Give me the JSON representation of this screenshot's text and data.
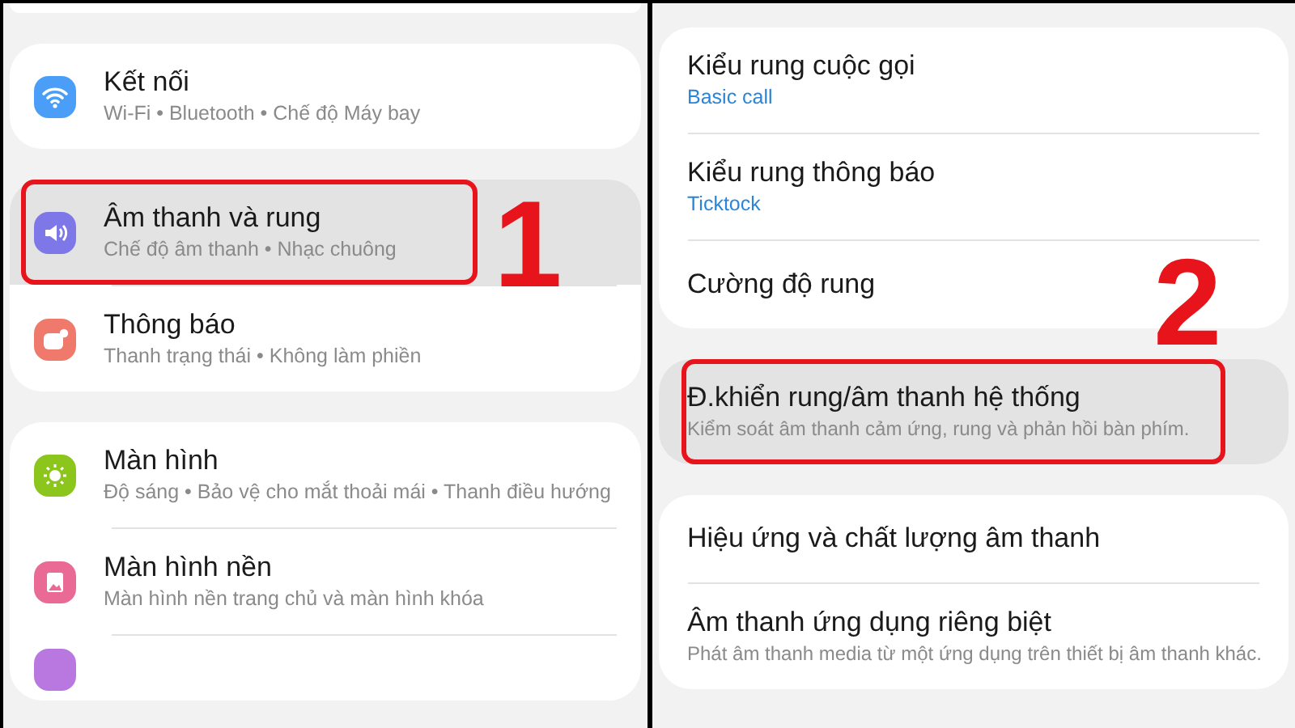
{
  "panels": [
    {
      "step": "1",
      "groups": [
        {
          "rows": [
            {
              "title": "Kết nối",
              "subtitle": "Wi-Fi • Bluetooth • Chế độ Máy bay",
              "kind": "description",
              "color": "#4a9ef7",
              "selected": false,
              "annotated": false
            }
          ]
        },
        {
          "rows": [
            {
              "title": "Âm thanh và rung",
              "subtitle": "Chế độ âm thanh • Nhạc chuông",
              "kind": "description",
              "color": "#7d77e8",
              "selected": true,
              "annotated": true
            },
            {
              "title": "Thông báo",
              "subtitle": "Thanh trạng thái • Không làm phiền",
              "kind": "description",
              "color": "#ef7a6b",
              "selected": false,
              "annotated": false
            }
          ]
        },
        {
          "rows": [
            {
              "title": "Màn hình",
              "subtitle": "Độ sáng • Bảo vệ cho mắt thoải mái • Thanh điều hướng",
              "kind": "description",
              "color": "#8cc61c",
              "selected": false,
              "annotated": false
            },
            {
              "title": "Màn hình nền",
              "subtitle": "Màn hình nền trang chủ và màn hình khóa",
              "kind": "description",
              "color": "#e96b95",
              "selected": false,
              "annotated": false
            }
          ],
          "more": {
            "color": "#b878e0"
          }
        }
      ]
    },
    {
      "step": "2",
      "groups": [
        {
          "rows": [
            {
              "title": "Kiểu rung cuộc gọi",
              "subtitle": "Basic call",
              "kind": "value",
              "selected": false,
              "annotated": false
            },
            {
              "title": "Kiểu rung thông báo",
              "subtitle": "Ticktock",
              "kind": "value",
              "selected": false,
              "annotated": false
            },
            {
              "title": "Cường độ rung",
              "kind": "plain",
              "selected": false,
              "annotated": false
            }
          ]
        },
        {
          "rows": [
            {
              "title": "Đ.khiển rung/âm thanh hệ thống",
              "subtitle": "Kiểm soát âm thanh cảm ứng, rung và phản hồi bàn phím.",
              "kind": "description",
              "selected": true,
              "annotated": true
            }
          ]
        },
        {
          "rows": [
            {
              "title": "Hiệu ứng và chất lượng âm thanh",
              "kind": "plain",
              "selected": false,
              "annotated": false
            },
            {
              "title": "Âm thanh ứng dụng riêng biệt",
              "subtitle": "Phát âm thanh media từ một ứng dụng trên thiết bị âm thanh khác.",
              "kind": "description",
              "selected": false,
              "annotated": false
            }
          ]
        }
      ]
    }
  ]
}
